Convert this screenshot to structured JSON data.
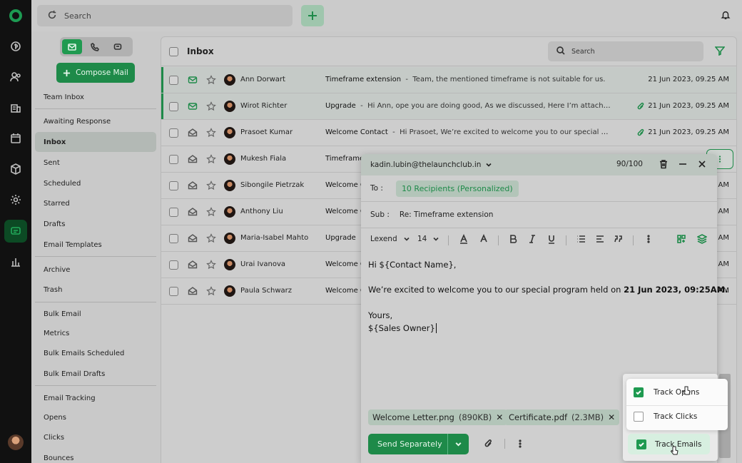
{
  "topbar": {
    "search_placeholder": "Search"
  },
  "sidebar": {
    "compose_label": "Compose Mail",
    "items": [
      {
        "label": "Team Inbox"
      },
      {
        "label": "Awaiting Response"
      },
      {
        "label": "Inbox"
      },
      {
        "label": "Sent"
      },
      {
        "label": "Scheduled"
      },
      {
        "label": "Starred"
      },
      {
        "label": "Drafts"
      },
      {
        "label": "Email Templates"
      },
      {
        "label": "Archive"
      },
      {
        "label": "Trash"
      },
      {
        "label": "Bulk Email"
      },
      {
        "label": "Metrics"
      },
      {
        "label": "Bulk Emails Scheduled"
      },
      {
        "label": "Bulk Email Drafts"
      },
      {
        "label": "Email Tracking"
      },
      {
        "label": "Opens"
      },
      {
        "label": "Clicks"
      },
      {
        "label": "Bounces"
      }
    ]
  },
  "inbox": {
    "title": "Inbox",
    "search_placeholder": "Search",
    "rows": [
      {
        "name": "Ann Dorwart",
        "subject": "Timeframe extension",
        "snippet": "Team, the mentioned timeframe is not suitable for us.",
        "date": "21 Jun 2023, 09.25 AM"
      },
      {
        "name": "Wirot Richter",
        "subject": "Upgrade",
        "snippet": "Hi Ann, ope you are doing good, As we discussed, Here I’m attaching ...",
        "date": "21 Jun 2023, 09.25 AM"
      },
      {
        "name": "Prasoet Kumar",
        "subject": "Welcome Contact",
        "snippet": "Hi Prasoet, We’re excited to welcome you to our special pro...",
        "date": "21 Jun 2023, 09.25 AM"
      },
      {
        "name": "Mukesh Fiala",
        "subject": "Timeframe",
        "snippet": "",
        "date": ""
      },
      {
        "name": "Sibongile Pietrzak",
        "subject": "Welcome C",
        "snippet": "",
        "date": "AM"
      },
      {
        "name": "Anthony Liu",
        "subject": "Welcome C",
        "snippet": "",
        "date": "AM"
      },
      {
        "name": "Maria-Isabel Mahto",
        "subject": "Upgrade",
        "snippet": "",
        "date": "AM"
      },
      {
        "name": "Urai Ivanova",
        "subject": "Welcome C",
        "snippet": "",
        "date": "AM"
      },
      {
        "name": "Paula Schwarz",
        "subject": "Welcome C",
        "snippet": "",
        "date": "AM"
      }
    ]
  },
  "compose": {
    "from": "kadin.lubin@thelaunchclub.in",
    "count": "90/100",
    "to_label": "To :",
    "to_chip": "10 Recipients (Personalized)",
    "sub_label": "Sub :",
    "subject": "Re: Timeframe extension",
    "font": "Lexend",
    "font_size": "14",
    "body": {
      "greeting": "Hi ${Contact Name},",
      "line_pre": "We’re excited to welcome you to our special program held on ",
      "line_bold": "21 Jun 2023, 09:25AM.",
      "closing": "Yours,",
      "signature": "${Sales Owner}"
    },
    "attachments": [
      {
        "name": "Welcome Letter.png",
        "size": "(890KB)"
      },
      {
        "name": "Certificate.pdf",
        "size": "(2.3MB)"
      }
    ],
    "send_label": "Send Separately"
  },
  "tracking": {
    "opens_label": "Track Opens",
    "clicks_label": "Track Clicks",
    "emails_label": "Track Emails",
    "opens_checked": true,
    "clicks_checked": false,
    "emails_checked": true
  },
  "colors": {
    "accent": "#1e8a49"
  }
}
